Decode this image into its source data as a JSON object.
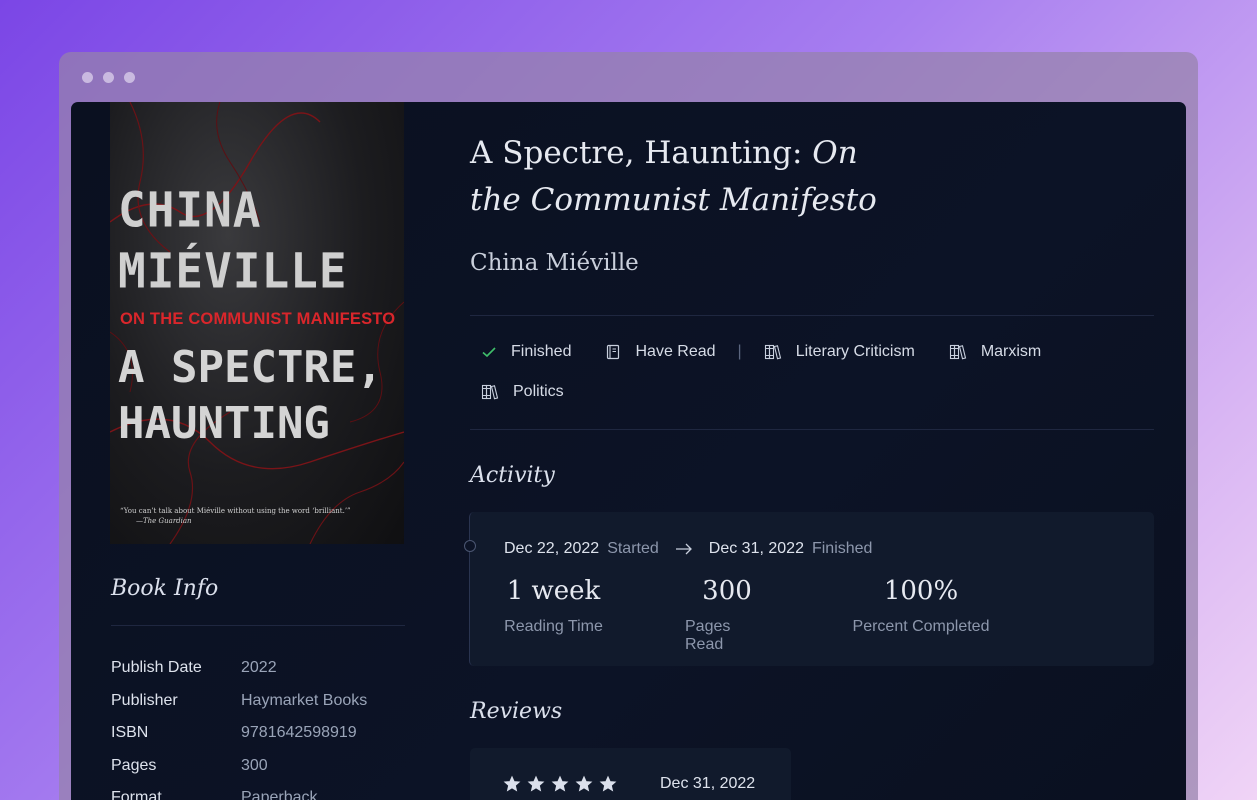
{
  "cover": {
    "author_line1": "CHINA",
    "author_line2": "MIÉVILLE",
    "subtitle": "ON THE COMMUNIST MANIFESTO",
    "title_line1": "A SPECTRE,",
    "title_line2": "HAUNTING",
    "quote": "“You can’t talk about Miéville without using the word ‘brilliant.’”",
    "quote_source": "—The Guardian"
  },
  "book": {
    "title_main": "A Spectre, Haunting:",
    "title_sub": "On the Communist Manifesto",
    "author": "China Miéville"
  },
  "tags": [
    {
      "label": "Finished",
      "icon": "check-icon"
    },
    {
      "label": "Have Read",
      "icon": "book-icon"
    },
    {
      "label": "Literary Criticism",
      "icon": "books-icon"
    },
    {
      "label": "Marxism",
      "icon": "books-icon"
    },
    {
      "label": "Politics",
      "icon": "books-icon"
    }
  ],
  "tag_separator": "|",
  "activity": {
    "title": "Activity",
    "start_date": "Dec 22, 2022",
    "start_label": "Started",
    "end_date": "Dec 31, 2022",
    "end_label": "Finished",
    "stats": [
      {
        "value": "1 week",
        "label": "Reading Time"
      },
      {
        "value": "300",
        "label": "Pages Read"
      },
      {
        "value": "100%",
        "label": "Percent Completed"
      }
    ]
  },
  "reviews": {
    "title": "Reviews",
    "rating": 5,
    "max_rating": 5,
    "date": "Dec 31, 2022"
  },
  "book_info": {
    "title": "Book Info",
    "rows": [
      {
        "label": "Publish Date",
        "value": "2022"
      },
      {
        "label": "Publisher",
        "value": "Haymarket Books"
      },
      {
        "label": "ISBN",
        "value": "9781642598919"
      },
      {
        "label": "Pages",
        "value": "300"
      },
      {
        "label": "Format",
        "value": "Paperback"
      }
    ]
  },
  "colors": {
    "background_start": "#7b46e6",
    "background_end": "#f0d4f6",
    "app_bg": "#0a1020",
    "card_bg": "#111a2c",
    "check_green": "#3fbf6b",
    "cover_red": "#d9262b"
  }
}
